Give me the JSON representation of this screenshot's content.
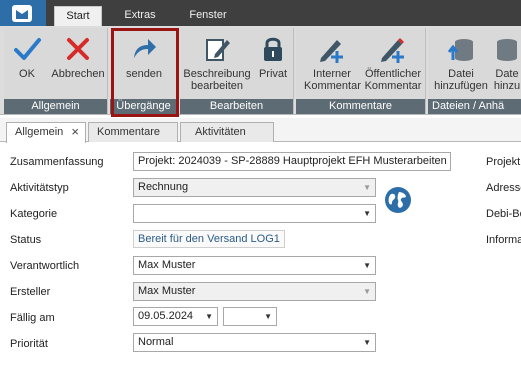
{
  "ribbon_tabs": [
    "Start",
    "Extras",
    "Fenster"
  ],
  "groups": {
    "allgemein": "Allgemein",
    "uebergaenge": "Übergänge",
    "bearbeiten": "Bearbeiten",
    "kommentare": "Kommentare",
    "dateien": "Dateien / Anhä"
  },
  "buttons": {
    "ok": "OK",
    "abbrechen": "Abbrechen",
    "senden": "senden",
    "beschreibung_1": "Beschreibung",
    "beschreibung_2": "bearbeiten",
    "privat": "Privat",
    "interner_1": "Interner",
    "interner_2": "Kommentar",
    "oeffentlicher_1": "Öffentlicher",
    "oeffentlicher_2": "Kommentar",
    "datei_1": "Datei",
    "datei_2": "hinzufügen",
    "datei2_1": "Date",
    "datei2_2": "hinzu"
  },
  "doc_tabs": [
    "Allgemein",
    "Kommentare",
    "Aktivitäten"
  ],
  "form": {
    "zusammenfassung": {
      "label": "Zusammenfassung",
      "value": "Projekt: 2024039 - SP-28889 Hauptprojekt EFH Musterarbeiten R"
    },
    "aktivitaetstyp": {
      "label": "Aktivitätstyp",
      "value": "Rechnung"
    },
    "kategorie": {
      "label": "Kategorie",
      "value": ""
    },
    "status": {
      "label": "Status",
      "value": "Bereit für den Versand LOG1"
    },
    "verantwortlich": {
      "label": "Verantwortlich",
      "value": "Max Muster"
    },
    "ersteller": {
      "label": "Ersteller",
      "value": "Max Muster"
    },
    "faellig_am": {
      "label": "Fällig am",
      "value": "09.05.2024",
      "time": ""
    },
    "prioritaet": {
      "label": "Priorität",
      "value": "Normal"
    }
  },
  "right_labels": [
    "Projekt",
    "Adresse",
    "Debi-Be",
    "Informa"
  ],
  "icons": [
    "app-logo-icon",
    "check-icon",
    "close-x-icon",
    "share-arrow-icon",
    "edit-doc-icon",
    "lock-icon",
    "add-comment-pen-icon",
    "add-comment-pen-red-icon",
    "database-upload-icon",
    "database-icon",
    "globe-icon",
    "chevron-down-icon"
  ],
  "colors": {
    "accent": "#2d6ea8",
    "highlight": "#9b1414",
    "group_label": "#5d6b74",
    "ok_check": "#2a7ac9",
    "cancel_x": "#d62b2b"
  }
}
